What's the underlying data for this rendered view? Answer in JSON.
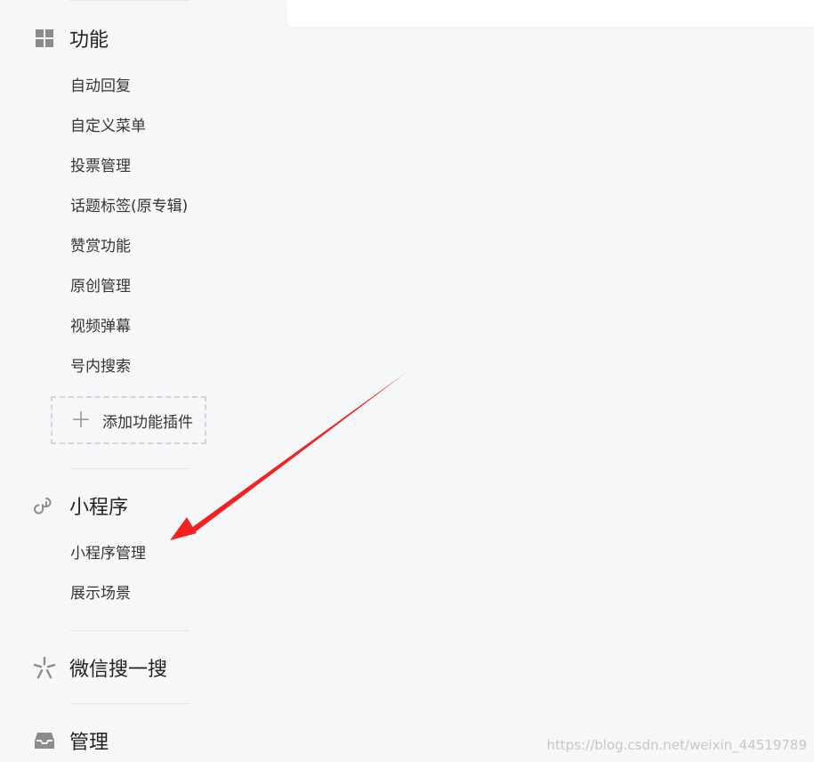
{
  "sections": {
    "features": {
      "title": "功能",
      "items": [
        "自动回复",
        "自定义菜单",
        "投票管理",
        "话题标签(原专辑)",
        "赞赏功能",
        "原创管理",
        "视频弹幕",
        "号内搜索"
      ],
      "add_plugin_label": "添加功能插件"
    },
    "mini_program": {
      "title": "小程序",
      "items": [
        "小程序管理",
        "展示场景"
      ]
    },
    "wechat_search": {
      "title": "微信搜一搜"
    },
    "management": {
      "title": "管理"
    }
  },
  "icons": {
    "features": "grid-icon",
    "mini_program": "link-icon",
    "wechat_search": "sparkle-icon",
    "management": "inbox-icon"
  },
  "annotation": {
    "arrow_color": "#f22222"
  },
  "watermark": "https://blog.csdn.net/weixin_44519789"
}
